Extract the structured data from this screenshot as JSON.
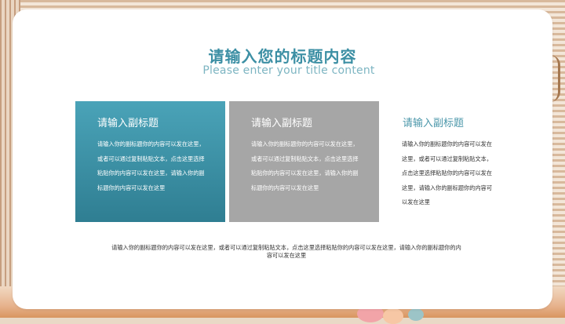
{
  "title": "请输入您的标题内容",
  "subtitle_en": "Please enter your title content",
  "boxes": [
    {
      "heading": "请输入副标题",
      "text": "请输入你的副标题你的内容可以发在这里，或者可以通过复制粘贴文本，点击这里选择粘贴你的内容可以发在这里，请输入你的副标题你的内容可以发在这里"
    },
    {
      "heading": "请输入副标题",
      "text": "请输入你的副标题你的内容可以发在这里，或者可以通过复制粘贴文本，点击这里选择粘贴你的内容可以发在这里，请输入你的副标题你的内容可以发在这里"
    },
    {
      "heading": "请输入副标题",
      "text": "请输入你的副标题你的内容可以发在这里，或者可以通过复制粘贴文本，点击这里选择粘贴你的内容可以发在这里，请输入你的副标题你的内容可以发在这里"
    }
  ],
  "footer": "请输入你的副标题你的内容可以发在这里，或者可以通过复制粘贴文本，点击这里选择粘贴你的内容可以发在这里，请输入你的副标题你的内容可以发在这里",
  "colors": {
    "accent": "#3c8fa4",
    "teal_box": "#4aa3b8",
    "gray_box": "#a6a6a6"
  }
}
